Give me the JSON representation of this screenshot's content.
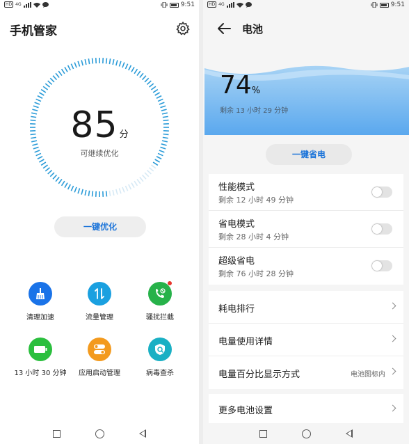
{
  "status_left": {
    "time": "9:51",
    "network_tag": "HD",
    "signal": "4G"
  },
  "status_right": {
    "time": "9:51",
    "network_tag": "HD",
    "signal": "4G"
  },
  "phone_manager": {
    "title": "手机管家",
    "score": "85",
    "score_unit": "分",
    "score_subtitle": "可继续优化",
    "score_level": 0.85,
    "optimize_button": "一键优化",
    "tools": [
      {
        "label": "清理加速",
        "icon": "broom-icon",
        "color": "#1a73e8"
      },
      {
        "label": "流量管理",
        "icon": "data-transfer-icon",
        "color": "#1aa0e0"
      },
      {
        "label": "骚扰拦截",
        "icon": "phone-block-icon",
        "color": "#27b24a"
      },
      {
        "label": "13 小时 30 分钟",
        "icon": "battery-icon",
        "color": "#2bbf3e"
      },
      {
        "label": "应用启动管理",
        "icon": "toggle-switch-icon",
        "color": "#f39a1e"
      },
      {
        "label": "病毒查杀",
        "icon": "shield-scan-icon",
        "color": "#1ab0c4"
      }
    ]
  },
  "battery": {
    "title": "电池",
    "percent": "74",
    "percent_unit": "%",
    "remaining": "剩余 13 小时 29 分钟",
    "save_button": "一键省电",
    "modes": [
      {
        "title": "性能模式",
        "subtitle": "剩余 12 小时 49 分钟",
        "enabled": false
      },
      {
        "title": "省电模式",
        "subtitle": "剩余 28 小时 4 分钟",
        "enabled": false
      },
      {
        "title": "超级省电",
        "subtitle": "剩余 76 小时 28 分钟",
        "enabled": false
      }
    ],
    "menu": [
      {
        "label": "耗电排行",
        "value": ""
      },
      {
        "label": "电量使用详情",
        "value": ""
      },
      {
        "label": "电量百分比显示方式",
        "value": "电池图标内"
      }
    ],
    "more_settings": "更多电池设置"
  },
  "colors": {
    "accent": "#1a73d9",
    "battery_gradient_top": "#a9d4f5",
    "battery_gradient_bottom": "#5aa8ee"
  }
}
